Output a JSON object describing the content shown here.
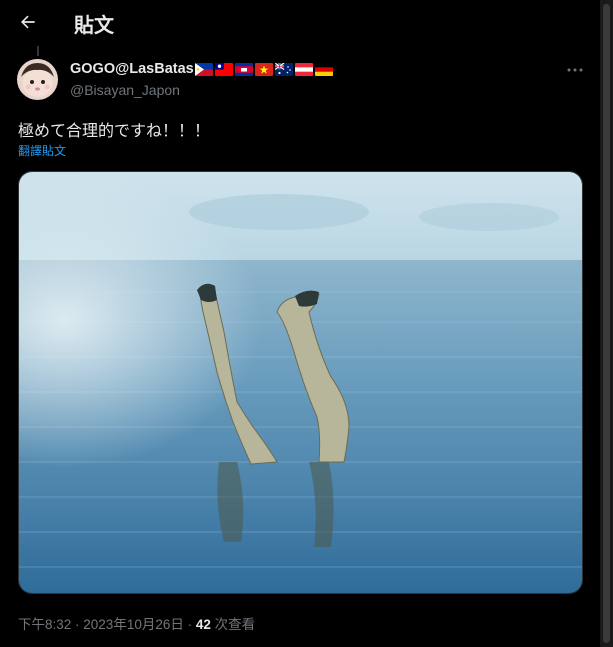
{
  "header": {
    "title": "貼文",
    "back_icon": "arrow-left-icon"
  },
  "author": {
    "display_name": "GOGO@LasBatas",
    "handle": "@Bisayan_Japon",
    "flags": [
      "philippines-flag",
      "taiwan-flag",
      "cambodia-flag",
      "vietnam-flag",
      "australia-flag",
      "austria-flag",
      "germany-flag"
    ]
  },
  "tweet": {
    "text": "極めて合理的ですね！！！",
    "translate_label": "翻譯貼文",
    "image_alt": "legs sticking out of calm blue water"
  },
  "meta": {
    "time": "下午8:32",
    "sep1": " · ",
    "date": "2023年10月26日",
    "sep2": " · ",
    "views_count": "42",
    "views_label": " 次查看"
  },
  "colors": {
    "accent": "#1d9bf0",
    "background": "#000000",
    "text": "#e7e9ea",
    "secondary": "#71767b"
  }
}
